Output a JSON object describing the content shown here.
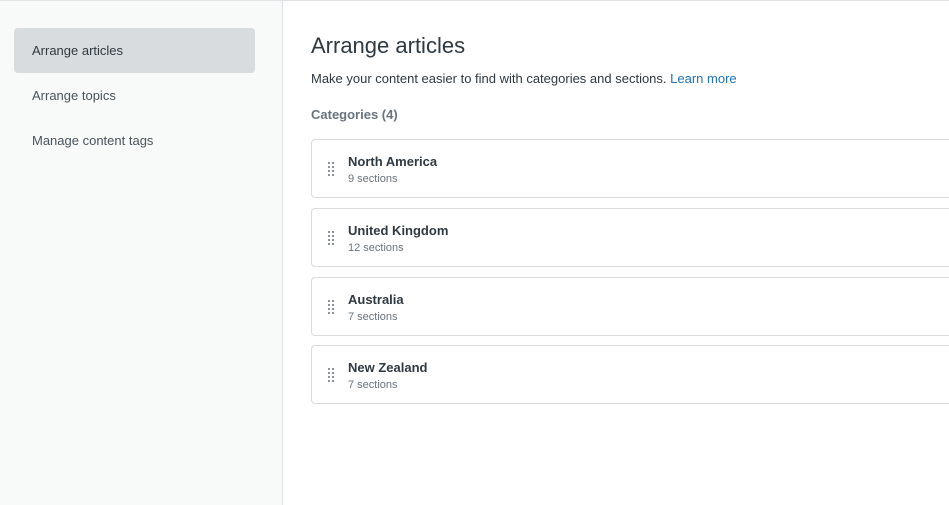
{
  "sidebar": {
    "items": [
      {
        "label": "Arrange articles",
        "active": true
      },
      {
        "label": "Arrange topics",
        "active": false
      },
      {
        "label": "Manage content tags",
        "active": false
      }
    ]
  },
  "main": {
    "title": "Arrange articles",
    "subtitle": "Make your content easier to find with categories and sections.",
    "learn_more": "Learn more",
    "categories_heading": "Categories (4)",
    "categories": [
      {
        "name": "North America",
        "sections": "9 sections"
      },
      {
        "name": "United Kingdom",
        "sections": "12 sections"
      },
      {
        "name": "Australia",
        "sections": "7 sections"
      },
      {
        "name": "New Zealand",
        "sections": "7 sections"
      }
    ]
  },
  "colors": {
    "link": "#1f73b7",
    "sidebar_bg": "#f8f9f9",
    "active_item_bg": "#d8dcde"
  },
  "icons": {
    "drag_handle": "drag-handle-icon"
  }
}
